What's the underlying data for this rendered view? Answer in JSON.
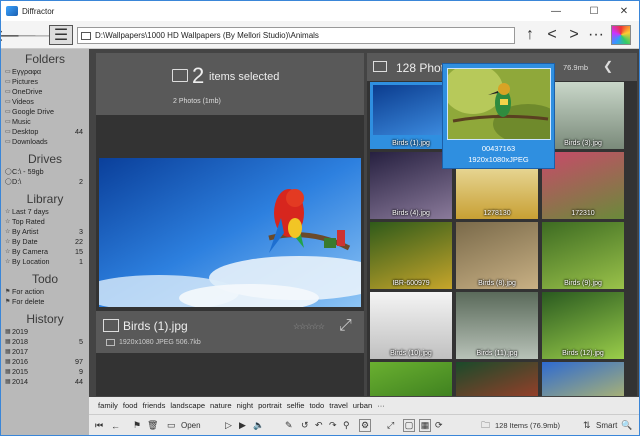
{
  "window": {
    "title": "Diffractor",
    "minimize_icon": "—",
    "maximize_icon": "☐",
    "close_icon": "✕"
  },
  "toolbar": {
    "back_icon": "🡐",
    "forward_icon": "🡒",
    "menu_icon": "☰",
    "address": "D:\\Wallpapers\\1000 HD Wallpapers (By Mellori Studio)\\Animals",
    "up_icon": "↑",
    "prev_icon": "<",
    "next_icon": ">",
    "more_icon": "···"
  },
  "sidebar": {
    "folders_header": "Folders",
    "folders": [
      {
        "label": "Εγγραφα",
        "count": ""
      },
      {
        "label": "Pictures",
        "count": ""
      },
      {
        "label": "OneDrive",
        "count": ""
      },
      {
        "label": "Videos",
        "count": ""
      },
      {
        "label": "Google Drive",
        "count": ""
      },
      {
        "label": "Music",
        "count": ""
      },
      {
        "label": "Desktop",
        "count": "44"
      },
      {
        "label": "Downloads",
        "count": ""
      }
    ],
    "drives_header": "Drives",
    "drives": [
      {
        "label": "C:\\ - 59gb",
        "count": ""
      },
      {
        "label": "D:\\",
        "count": "2"
      }
    ],
    "library_header": "Library",
    "library": [
      {
        "label": "Last 7 days",
        "count": ""
      },
      {
        "label": "Top Rated",
        "count": ""
      },
      {
        "label": "By Artist",
        "count": "3"
      },
      {
        "label": "By Date",
        "count": "22"
      },
      {
        "label": "By Camera",
        "count": "15"
      },
      {
        "label": "By Location",
        "count": "1"
      }
    ],
    "todo_header": "Todo",
    "todo": [
      {
        "label": "For action",
        "count": ""
      },
      {
        "label": "For delete",
        "count": ""
      }
    ],
    "history_header": "History",
    "history": [
      {
        "label": "2019",
        "count": ""
      },
      {
        "label": "2018",
        "count": "5"
      },
      {
        "label": "2017",
        "count": ""
      },
      {
        "label": "2016",
        "count": "97"
      },
      {
        "label": "2015",
        "count": "9"
      },
      {
        "label": "2014",
        "count": "44"
      }
    ]
  },
  "selection": {
    "count": "2",
    "label": "items selected",
    "detail": "2 Photos (1mb)"
  },
  "preview": {
    "name": "Birds (1).jpg",
    "meta": "1920x1080 JPEG 506.7kb",
    "stars": "☆☆☆☆☆"
  },
  "grid": {
    "header_count": "128 Photo",
    "header_size": "76.9mb",
    "thumbs": [
      {
        "label": "Birds (1).jpg"
      },
      {
        "label": ""
      },
      {
        "label": "Birds (3).jpg"
      },
      {
        "label": "Birds (4).jpg"
      },
      {
        "label": "1278130"
      },
      {
        "label": "172310"
      },
      {
        "label": "IBR-600979"
      },
      {
        "label": "Birds (8).jpg"
      },
      {
        "label": "Birds (9).jpg"
      },
      {
        "label": "Birds (10).jpg"
      },
      {
        "label": "Birds (11).jpg"
      },
      {
        "label": "Birds (12).jpg"
      },
      {
        "label": ""
      },
      {
        "label": ""
      },
      {
        "label": ""
      }
    ]
  },
  "popup": {
    "name": "00437163",
    "meta": "1920x1080xJPEG"
  },
  "tags": [
    "family",
    "food",
    "friends",
    "landscape",
    "nature",
    "night",
    "portrait",
    "selfie",
    "todo",
    "travel",
    "urban",
    "···"
  ],
  "bottom": {
    "open_label": "Open",
    "photos_count": "128 Items (76.9mb)",
    "sort_label": "Smart"
  }
}
